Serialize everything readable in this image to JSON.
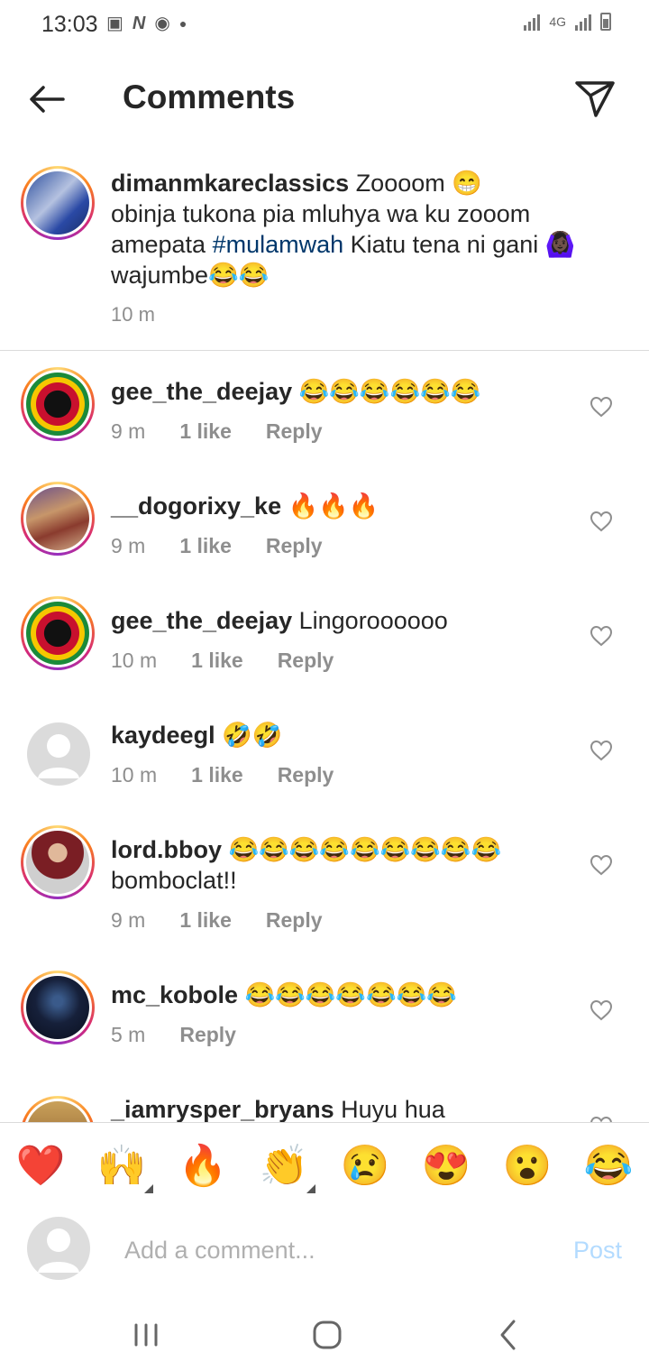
{
  "status": {
    "time": "13:03",
    "network": "4G"
  },
  "header": {
    "title": "Comments"
  },
  "caption": {
    "username": "dimanmkareclassics",
    "text_1": " Zoooom 😁",
    "text_2": "obinja tukona pia mluhya wa ku zooom amepata ",
    "hashtag": "#mulamwah",
    "text_3": "  Kiatu tena ni gani 🙆🏿‍♀️ wajumbe😂😂",
    "time": "10 m"
  },
  "comments": [
    {
      "username": "gee_the_deejay",
      "text": " 😂😂😂😂😂😂",
      "time": "9 m",
      "likes": "1 like",
      "reply": "Reply"
    },
    {
      "username": "__dogorixy_ke",
      "text": " 🔥🔥🔥",
      "time": "9 m",
      "likes": "1 like",
      "reply": "Reply"
    },
    {
      "username": "gee_the_deejay",
      "text": " Lingoroooooo",
      "time": "10 m",
      "likes": "1 like",
      "reply": "Reply"
    },
    {
      "username": "kaydeegl",
      "text": " 🤣🤣",
      "time": "10 m",
      "likes": "1 like",
      "reply": "Reply"
    },
    {
      "username": "lord.bboy",
      "text": " 😂😂😂😂😂😂😂😂😂 bomboclat!!",
      "time": "9 m",
      "likes": "1 like",
      "reply": "Reply"
    },
    {
      "username": "mc_kobole",
      "text": " 😂😂😂😂😂😂😂",
      "time": "5 m",
      "likes": "",
      "reply": "Reply"
    },
    {
      "username": "_iamrysper_bryans",
      "text": " Huyu hua"
    }
  ],
  "reactions": [
    "❤️",
    "🙌",
    "🔥",
    "👏",
    "😢",
    "😍",
    "😮",
    "😂"
  ],
  "composer": {
    "placeholder": "Add a comment...",
    "post_label": "Post"
  },
  "colors": {
    "link": "#00376b",
    "post_disabled": "#b3dbff",
    "secondary": "#8e8e8e"
  }
}
